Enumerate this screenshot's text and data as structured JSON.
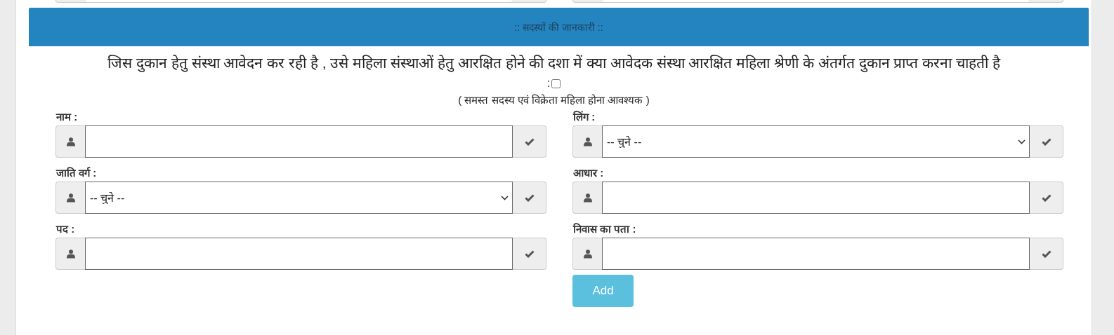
{
  "section_header": ":: सदस्यों की जानकारी ::",
  "question": {
    "text": "जिस दुकान हेतु संस्था आवेदन कर रही है , उसे महिला संस्थाओं हेतु आरक्षित होने की दशा में क्या आवेदक संस्था आरक्षित महिला श्रेणी के अंतर्गत दुकान प्राप्त करना चाहती है",
    "suffix": ":",
    "checked": false
  },
  "note": "( समस्त सदस्य एवं विक्रेता महिला होना आवश्यक )",
  "fields": [
    {
      "label": "नाम :",
      "kind": "text"
    },
    {
      "label": "लिंग :",
      "kind": "select",
      "value": "-- चुने --"
    },
    {
      "label": "जाति वर्ग :",
      "kind": "select",
      "value": "-- चुने --"
    },
    {
      "label": "आधार :",
      "kind": "text"
    },
    {
      "label": "पद :",
      "kind": "text"
    },
    {
      "label": "निवास का पता :",
      "kind": "text"
    }
  ],
  "add_button": "Add"
}
